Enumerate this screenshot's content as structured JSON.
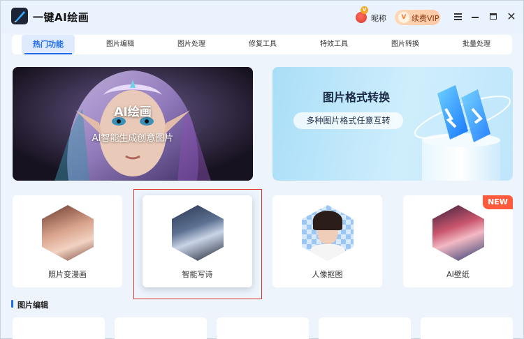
{
  "app": {
    "title": "一键AI绘画"
  },
  "user": {
    "nickname": "昵称",
    "badge": "V"
  },
  "vip": {
    "label": "续费VIP",
    "icon_text": "V"
  },
  "window": {
    "close_glyph": "✕"
  },
  "tabs": [
    {
      "label": "热门功能",
      "active": true
    },
    {
      "label": "图片编辑",
      "active": false
    },
    {
      "label": "图片处理",
      "active": false
    },
    {
      "label": "修复工具",
      "active": false
    },
    {
      "label": "特效工具",
      "active": false
    },
    {
      "label": "图片转换",
      "active": false
    },
    {
      "label": "批量处理",
      "active": false
    }
  ],
  "banners": {
    "ai": {
      "title": "AI绘画",
      "subtitle": "AI智能生成创意图片"
    },
    "convert": {
      "title": "图片格式转换",
      "subtitle": "多种图片格式任意互转"
    }
  },
  "features": [
    {
      "label": "照片变漫画",
      "icon": "manga-portrait-icon"
    },
    {
      "label": "智能写诗",
      "icon": "poet-writer-icon",
      "selected": true
    },
    {
      "label": "人像抠图",
      "icon": "portrait-cutout-icon"
    },
    {
      "label": "AI壁纸",
      "icon": "wallpaper-portrait-icon",
      "badge": "NEW"
    }
  ],
  "section": {
    "title": "图片编辑"
  },
  "colors": {
    "accent": "#1f6cf0",
    "new_badge": "#ff5a3c",
    "selection_frame": "#e0342d"
  }
}
